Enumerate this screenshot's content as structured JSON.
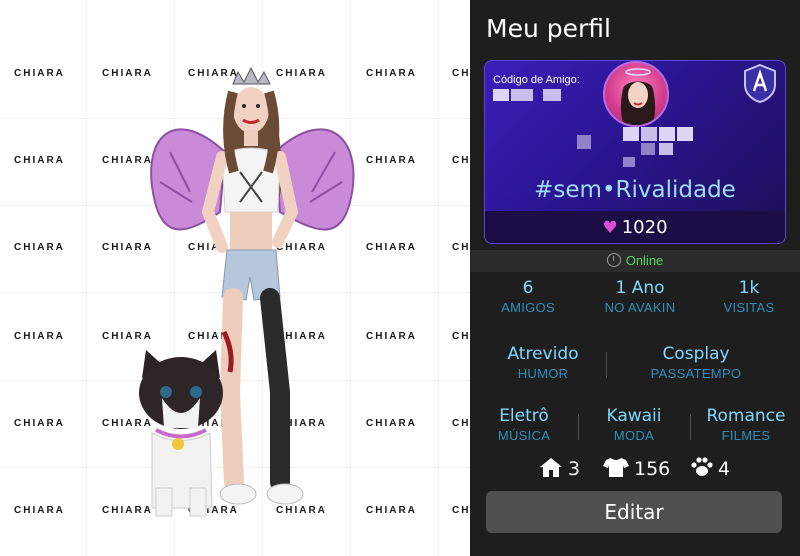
{
  "watermark": {
    "text": "CHIARA"
  },
  "panel": {
    "title": "Meu perfil",
    "card": {
      "friend_code_label": "Código de Amigo:",
      "tag": "#sem•Rivalidade",
      "likes": "1020"
    },
    "status": "Online",
    "stats_row1": [
      {
        "value": "6",
        "label": "AMIGOS"
      },
      {
        "value": "1 Ano",
        "label": "NO AVAKIN"
      },
      {
        "value": "1k",
        "label": "VISITAS"
      }
    ],
    "stats_row2": [
      {
        "value": "Atrevido",
        "label": "HUMOR"
      },
      {
        "value": "Cosplay",
        "label": "PASSATEMPO"
      }
    ],
    "stats_row3": [
      {
        "value": "Eletrô",
        "label": "MÚSICA"
      },
      {
        "value": "Kawaii",
        "label": "MODA"
      },
      {
        "value": "Romance",
        "label": "FILMES"
      }
    ],
    "counts": {
      "homes": "3",
      "outfits": "156",
      "pets": "4"
    },
    "edit_label": "Editar"
  },
  "colors": {
    "panel_bg": "#1e1e1e",
    "accent_blue": "#7fd8ff",
    "card_purple": "#3a1fb8",
    "online_green": "#4fd55e",
    "heart_pink": "#e24ad8"
  }
}
